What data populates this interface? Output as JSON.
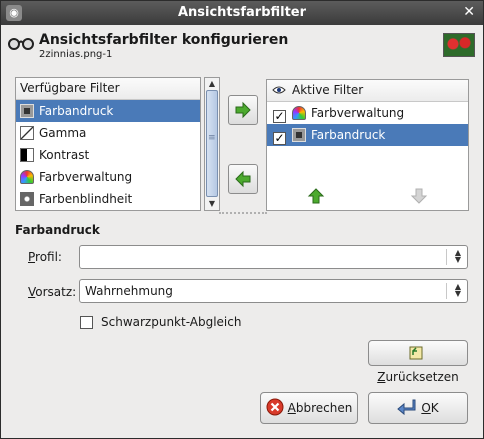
{
  "window": {
    "title": "Ansichtsfarbfilter"
  },
  "header": {
    "title": "Ansichtsfarbfilter konfigurieren",
    "subtitle": "2zinnias.png-1"
  },
  "available": {
    "heading": "Verfügbare Filter",
    "items": [
      {
        "label": "Farbandruck",
        "icon": "printer-icon"
      },
      {
        "label": "Gamma",
        "icon": "gamma-icon"
      },
      {
        "label": "Kontrast",
        "icon": "contrast-icon"
      },
      {
        "label": "Farbverwaltung",
        "icon": "color-management-icon"
      },
      {
        "label": "Farbenblindheit",
        "icon": "color-blindness-icon"
      }
    ]
  },
  "active": {
    "heading": "Aktive Filter",
    "items": [
      {
        "label": "Farbverwaltung",
        "checked": true
      },
      {
        "label": "Farbandruck",
        "checked": true
      }
    ]
  },
  "config": {
    "section_title": "Farbandruck",
    "profile_label_rest": "rofil:",
    "profile_label_mnemonic": "P",
    "profile_value": "",
    "intent_label_mnemonic": "V",
    "intent_label_rest": "orsatz:",
    "intent_value": "Wahrnehmung",
    "blackpoint_label": "Schwarzpunkt-Abgleich",
    "reset_mnemonic": "Z",
    "reset_rest": "urücksetzen"
  },
  "footer": {
    "cancel_mnemonic": "A",
    "cancel_rest": "bbrechen",
    "ok_mnemonic": "O",
    "ok_rest": "K"
  },
  "colors": {
    "selection": "#4a7ab8",
    "titlebar": "#4a4a4a",
    "arrow_green": "#3a9a2a"
  }
}
